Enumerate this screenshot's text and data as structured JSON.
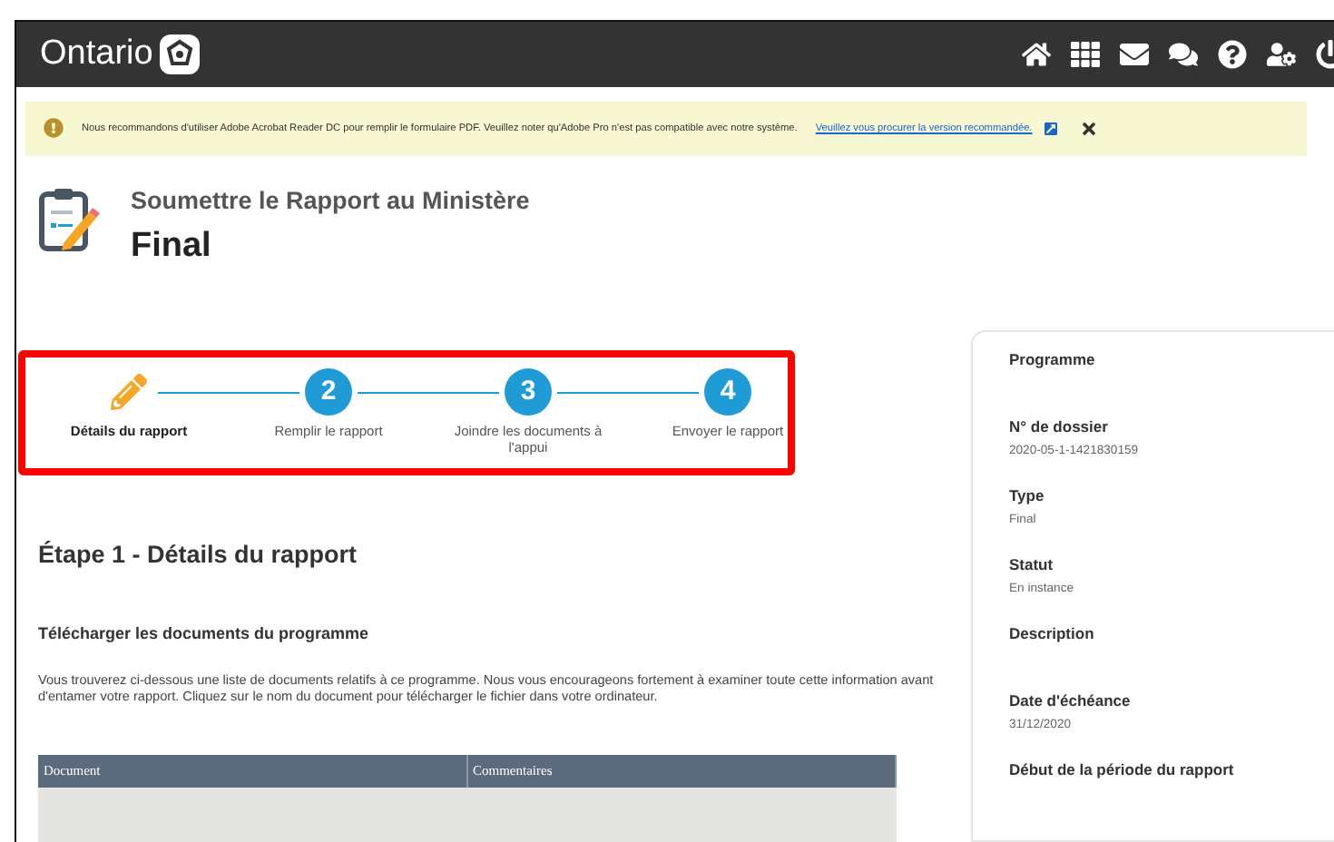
{
  "header": {
    "brand": "Ontario"
  },
  "banner": {
    "message": "Nous recommandons d'utiliser Adobe Acrobat Reader DC pour remplir le formulaire PDF. Veuillez noter qu'Adobe Pro n'est pas compatible avec notre système.",
    "link": "Veuillez vous procurer la version recommandée."
  },
  "page": {
    "subtitle": "Soumettre le Rapport au Ministère",
    "title": "Final"
  },
  "steps": [
    {
      "kind": "current",
      "label": "Détails du rapport"
    },
    {
      "kind": "number",
      "number": "2",
      "label": "Remplir le rapport"
    },
    {
      "kind": "number",
      "number": "3",
      "label": "Joindre les documents à l'appui"
    },
    {
      "kind": "number",
      "number": "4",
      "label": "Envoyer le rapport"
    }
  ],
  "section": {
    "heading": "Étape 1 - Détails du rapport",
    "subheading": "Télécharger les documents du programme",
    "paragraph": "Vous trouverez ci-dessous une liste de documents relatifs à ce programme. Nous vous encourageons fortement à examiner toute cette information avant d'entamer votre rapport. Cliquez sur le nom du document pour télécharger le fichier dans votre ordinateur."
  },
  "table": {
    "columns": [
      "Document",
      "Commentaires"
    ]
  },
  "details": [
    {
      "label": "Programme"
    },
    {
      "label": "N° de dossier",
      "value": "2020-05-1-1421830159"
    },
    {
      "label": "Type",
      "value": "Final"
    },
    {
      "label": "Statut",
      "value": "En instance"
    },
    {
      "label": "Description"
    },
    {
      "label": "Date d'échéance",
      "value": "31/12/2020"
    },
    {
      "label": "Début de la période du rapport"
    }
  ]
}
